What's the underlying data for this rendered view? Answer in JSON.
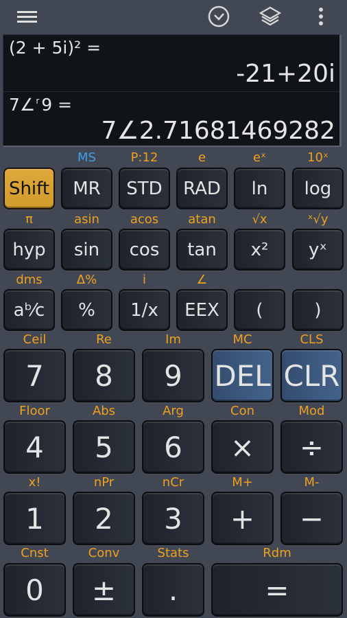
{
  "topbar": {
    "icons": [
      "menu-icon",
      "history-icon",
      "layers-icon",
      "more-vert-icon"
    ]
  },
  "display": {
    "line1": {
      "expression": "(2 + 5i)² =",
      "result": "-21+20i"
    },
    "line2": {
      "expression_base": "7∠",
      "expression_sup": "r",
      "expression_rest": "9 =",
      "result": "7∠2.71681469282"
    }
  },
  "colors": {
    "shift_label": "#f0a020",
    "memory_label": "#3aa0f0",
    "shift_key": "#d9a236",
    "action_key": "#3d5a80",
    "key_bg": "#252a33",
    "background": "#414853",
    "display_bg": "#101318"
  },
  "rows": {
    "r1": {
      "labels": [
        "",
        "MS",
        "P:12",
        "e",
        "eˣ",
        "10ˣ"
      ],
      "keys": [
        "Shift",
        "MR",
        "STD",
        "RAD",
        "ln",
        "log"
      ]
    },
    "r2": {
      "labels": [
        "π",
        "asin",
        "acos",
        "atan",
        "√x",
        "ˣ√y"
      ],
      "keys": [
        "hyp",
        "sin",
        "cos",
        "tan",
        "x²",
        "yˣ"
      ]
    },
    "r3": {
      "labels": [
        "dms",
        "Δ%",
        "i",
        "∠",
        "",
        ""
      ],
      "keys": [
        "aᵇ⁄c",
        "%",
        "1/x",
        "EEX",
        "(",
        ")"
      ]
    },
    "r4": {
      "labels": [
        "Ceil",
        "Re",
        "Im",
        "MC",
        "CLS"
      ],
      "keys": [
        "7",
        "8",
        "9",
        "DEL",
        "CLR"
      ]
    },
    "r5": {
      "labels": [
        "Floor",
        "Abs",
        "Arg",
        "Con",
        "Mod"
      ],
      "keys": [
        "4",
        "5",
        "6",
        "×",
        "÷"
      ]
    },
    "r6": {
      "labels": [
        "x!",
        "nPr",
        "nCr",
        "M+",
        "M-"
      ],
      "keys": [
        "1",
        "2",
        "3",
        "+",
        "−"
      ]
    },
    "r7": {
      "labels": [
        "Cnst",
        "Conv",
        "Stats",
        "Rdm"
      ],
      "keys": [
        "0",
        "±",
        ".",
        "="
      ]
    }
  }
}
